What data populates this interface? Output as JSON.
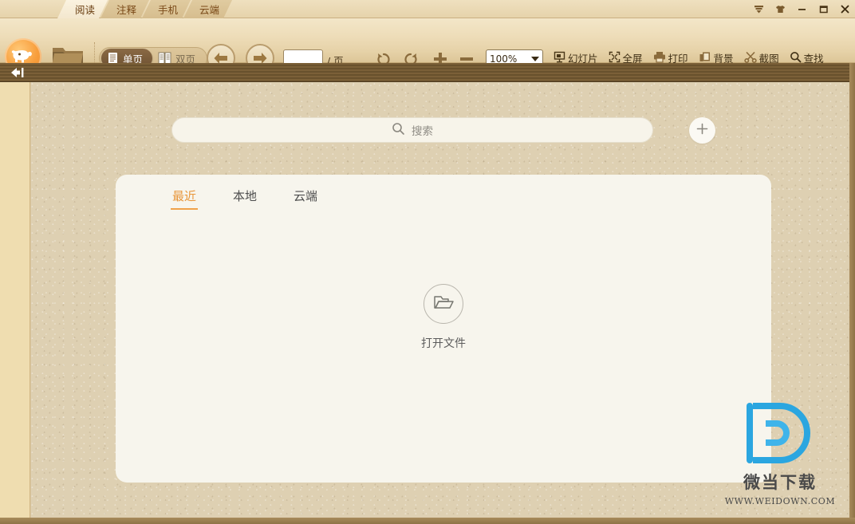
{
  "window": {
    "tabs": [
      {
        "label": "阅读",
        "active": true
      },
      {
        "label": "注释",
        "active": false
      },
      {
        "label": "手机",
        "active": false
      },
      {
        "label": "云端",
        "active": false
      }
    ],
    "controls": [
      {
        "name": "menu-dropdown",
        "icon": "chevron-down-icon"
      },
      {
        "name": "skin",
        "icon": "tshirt-icon"
      },
      {
        "name": "minimize",
        "icon": "minimize-icon"
      },
      {
        "name": "maximize",
        "icon": "maximize-icon"
      },
      {
        "name": "close",
        "icon": "close-icon"
      }
    ]
  },
  "toolbar": {
    "logo_alt": "elephant-logo",
    "open_alt": "open-folder-icon",
    "page_mode": {
      "single": "单页",
      "double": "双页",
      "active": "单页"
    },
    "nav": {
      "back": "后退",
      "forward": "前进"
    },
    "page_input_value": "",
    "page_suffix": "/ 页",
    "rotate_left": "向左旋转",
    "rotate_right": "向右旋转",
    "zoom_in": "放大",
    "zoom_out": "缩小",
    "zoom_value": "100%",
    "actions": [
      {
        "label": "幻灯片",
        "icon": "slideshow-icon"
      },
      {
        "label": "全屏",
        "icon": "fullscreen-icon"
      },
      {
        "label": "打印",
        "icon": "printer-icon"
      },
      {
        "label": "背景",
        "icon": "background-icon"
      },
      {
        "label": "截图",
        "icon": "scissors-icon"
      },
      {
        "label": "查找",
        "icon": "search-icon"
      }
    ]
  },
  "darkbar": {
    "collapse_label": "收起侧栏",
    "collapse_icon": "collapse-left-icon"
  },
  "main": {
    "search": {
      "placeholder": "搜索",
      "value": "",
      "icon": "search-icon"
    },
    "add_button": {
      "label": "+",
      "icon": "plus-icon"
    },
    "tabs": [
      {
        "label": "最近",
        "active": true
      },
      {
        "label": "本地",
        "active": false
      },
      {
        "label": "云端",
        "active": false
      }
    ],
    "empty_state": {
      "label": "打开文件",
      "icon": "folder-open-icon"
    }
  },
  "watermark": {
    "logo_alt": "weidown-d-logo",
    "cn": "微当下载",
    "url": "WWW.WEIDOWN.COM",
    "color": "#29a8e0"
  },
  "colors": {
    "accent": "#e8973c",
    "toolbar_bg": "#eeddb9",
    "content_bg": "#ded0b2",
    "card_bg": "#f7f5ed",
    "darkbar": "#6e552f"
  }
}
